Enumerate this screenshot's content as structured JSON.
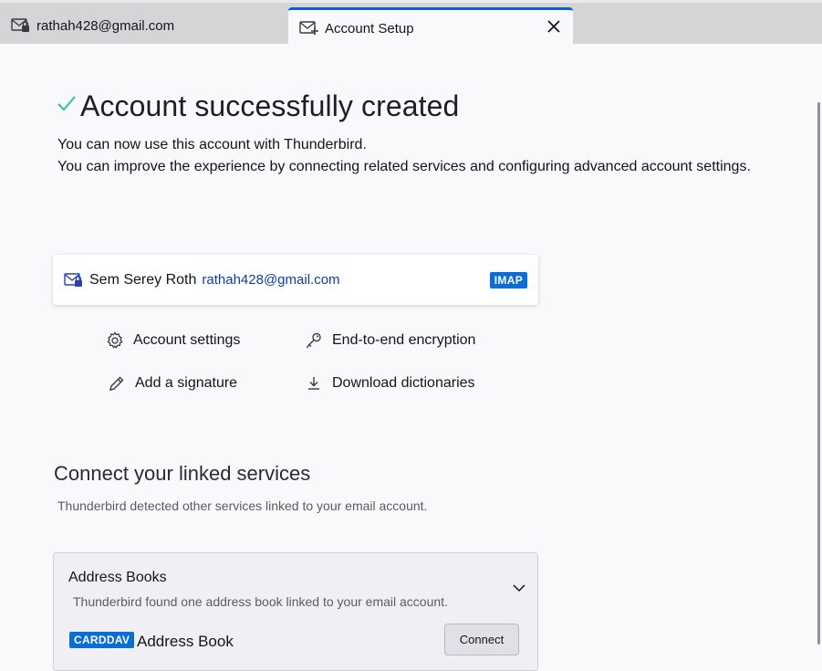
{
  "tabs": [
    {
      "label": "rathah428@gmail.com",
      "icon": "mail-lock-icon",
      "active": false
    },
    {
      "label": "Account Setup",
      "icon": "mail-setup-icon",
      "active": true
    }
  ],
  "header": {
    "title": "Account successfully created",
    "line1": "You can now use this account with Thunderbird.",
    "line2": "You can improve the experience by connecting related services and configuring advanced account settings."
  },
  "account": {
    "name": "Sem Serey Roth",
    "email": "rathah428@gmail.com",
    "protocol": "IMAP"
  },
  "actions": {
    "settings": "Account settings",
    "e2e": "End-to-end encryption",
    "signature": "Add a signature",
    "dictionaries": "Download dictionaries"
  },
  "linked": {
    "title": "Connect your linked services",
    "subtitle": "Thunderbird detected other services linked to your email account.",
    "address_books": {
      "title": "Address Books",
      "subtitle": "Thunderbird found one address book linked to your email account.",
      "badge": "CARDDAV",
      "name": "Address Book",
      "button": "Connect"
    }
  },
  "colors": {
    "accent": "#0b5fd6",
    "badge": "#0b6dd6",
    "success": "#2ac3a2",
    "link": "#0b3ea8"
  }
}
